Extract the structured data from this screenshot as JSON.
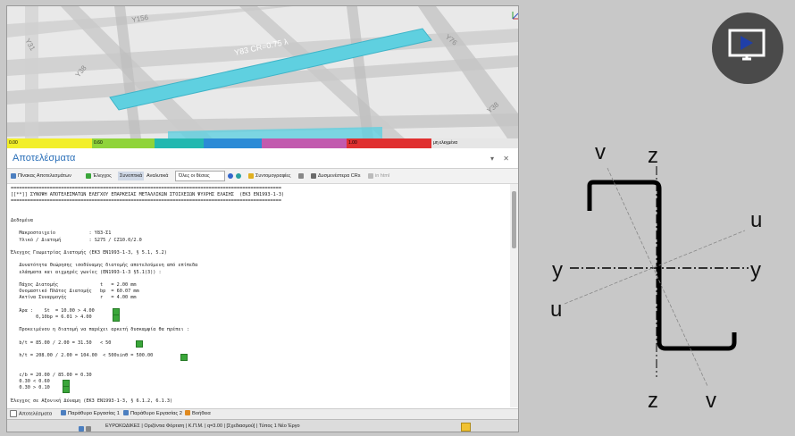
{
  "viewport": {
    "labels": [
      "Y156",
      "Y31",
      "Y38",
      "Y83 CR=0.75 λ",
      "Y76",
      "Y38"
    ],
    "highlight_color": "#5fd0e0"
  },
  "legend": [
    {
      "label": "0.00",
      "color": "#f2ef2a"
    },
    {
      "label": "0.60",
      "color": "#8fd43a"
    },
    {
      "label": "",
      "color": "#22b8b0"
    },
    {
      "label": "",
      "color": "#2b8bd6"
    },
    {
      "label": "",
      "color": "#c25aae"
    },
    {
      "label": "1.00",
      "color": "#e03030"
    },
    {
      "label": "μη ελεγμένα",
      "color": "#e6e6e6"
    }
  ],
  "panel": {
    "title": "Αποτελέσματα",
    "controls": "▾ ✕"
  },
  "toolbar": {
    "results_table": "Πίνακας Αποτελεσμάτων",
    "checks": "Έλεγχος",
    "summary": "Συνοπτικά",
    "detailed": "Αναλυτικά",
    "positions_select": "Όλες οι θέσεις",
    "suggestions": "Συντομογραφίες",
    "recalculate_crs": "Δυσμενέστερα CRs",
    "html": "in html"
  },
  "report_lines": [
    "=================================================================================================",
    "[[**]] ΣΥΝΟΨΗ ΑΠΟΤΕΛΕΣΜΑΤΩΝ ΕΛΕΓΧΟΥ ΕΠΑΡΚΕΙΑΣ ΜΕΤΑΛΛΙΚΩΝ ΣΤΟΙΧΕΙΩΝ ΨΥΧΡΗΣ ΕΛΑΣΗΣ  (ΕΚ3 EN1993-1-3)",
    "=================================================================================================",
    "",
    "",
    "Δεδομένα",
    "",
    "   Μακροστοιχείο            : Y83-Σ1",
    "   Υλικό / Διατομή          : S275 / CZ10.0/2.0",
    "",
    "Έλεγχος Γεωμετρίας Διατομής (ΕΚ3 EN1993-1-3, § 5.1, 5.2)",
    "",
    "   Δυνατότητα Θεώρησης ισοδύναμης διατομής αποτελούμενη από επίπεδα",
    "   ελάσματα και αιχμηρές γωνίες (EN1993-1-3 §5.1(3)) :",
    "",
    "   Πάχος Διατομής               t   = 2.00 mm",
    "   Ονομαστικό Πλάτος Διατομής   bp  = 60.07 mm",
    "   Ακτίνα Συναρμογής            r   = 4.00 mm",
    "",
    "   Άρα :    St  = 10.00 > 4.00",
    "         0,10bp = 6.01 > 4.00",
    "",
    "   Προκειμένου η διατομή να παρέχει αρκετή δυσκαμψία θα πρέπει :",
    "",
    "   b/t = 85.00 / 2.00 = 31.50   < 50",
    "",
    "   h/t = 208.00 / 2.00 = 104.00  < 500sinθ = 500.00",
    "",
    "",
    "   c/b = 20.00 / 85.00 = 0.30",
    "   0.30 < 0.60",
    "   0.30 > 0.10",
    "",
    "Έλεγχος σε Αξονική Δύναμη (ΕΚ3 EN1993-1-3, § 6.1.2, 6.1.3)"
  ],
  "tabs": [
    "Αποτελέσματα",
    "Παράθυρο Εργασίας 1",
    "Παράθυρο Εργασίας 2",
    "Βοήθεια"
  ],
  "status": "ΕΥΡΩΚΩΔΙΚΕΣ | Οριζόντια Φόρτιση | Κ.Π.Μ. | q=3.00 | [Σχεδιασμού] | Τύπος 1          Νέο Έργο",
  "section_labels": {
    "z_top": "z",
    "z_bottom": "z",
    "v_top": "v",
    "v_bottom": "v",
    "u_right": "u",
    "u_left": "u",
    "y_left": "y",
    "y_right": "y"
  },
  "icons": {
    "play": "play-video-icon"
  }
}
